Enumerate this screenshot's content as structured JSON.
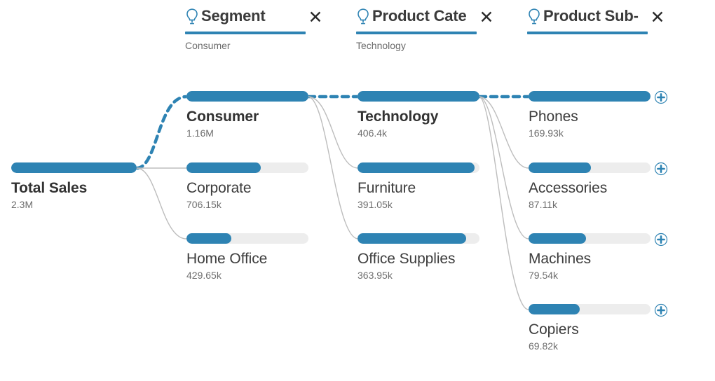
{
  "chart_data": {
    "type": "bar",
    "title": "Total Sales breakdown",
    "layout": "horizontal decomposition tree with connector links",
    "legend": "none",
    "grid": false,
    "root": {
      "label": "Total Sales",
      "value": "2.3M",
      "numeric": 2300000,
      "pct": 100,
      "selected": true
    },
    "columns": [
      {
        "dimension": "Segment",
        "selection": "Consumer",
        "items": [
          {
            "label": "Consumer",
            "value": "1.16M",
            "numeric": 1160000,
            "pct": 100,
            "selected": true
          },
          {
            "label": "Corporate",
            "value": "706.15k",
            "numeric": 706150,
            "pct": 61,
            "selected": false
          },
          {
            "label": "Home Office",
            "value": "429.65k",
            "numeric": 429650,
            "pct": 37,
            "selected": false
          }
        ]
      },
      {
        "dimension": "Product Category",
        "selection": "Technology",
        "items": [
          {
            "label": "Technology",
            "value": "406.4k",
            "numeric": 406400,
            "pct": 100,
            "selected": true
          },
          {
            "label": "Furniture",
            "value": "391.05k",
            "numeric": 391050,
            "pct": 96,
            "selected": false
          },
          {
            "label": "Office Supplies",
            "value": "363.95k",
            "numeric": 363950,
            "pct": 89,
            "selected": false
          }
        ]
      },
      {
        "dimension": "Product Sub-Category",
        "selection": "",
        "items": [
          {
            "label": "Phones",
            "value": "169.93k",
            "numeric": 169930,
            "pct": 100,
            "selected": false
          },
          {
            "label": "Accessories",
            "value": "87.11k",
            "numeric": 87110,
            "pct": 51,
            "selected": false
          },
          {
            "label": "Machines",
            "value": "79.54k",
            "numeric": 79540,
            "pct": 47,
            "selected": false
          },
          {
            "label": "Copiers",
            "value": "69.82k",
            "numeric": 69820,
            "pct": 42,
            "selected": false
          }
        ]
      }
    ]
  },
  "colors": {
    "accent": "#2e83b3",
    "bar_track": "#ededed",
    "link": "#bdbdbd",
    "link_active": "#2e83b3",
    "label": "#3d3d3d",
    "value": "#6e6e6e",
    "close": "#2b2b2b"
  },
  "breadcrumbs": [
    {
      "title": "Segment",
      "title_display": "Segment",
      "subtitle": "Consumer",
      "close_label": "✕",
      "icon": "lightbulb-icon",
      "truncated": false
    },
    {
      "title": "Product Category",
      "title_display": "Product Cate",
      "subtitle": "Technology",
      "close_label": "✕",
      "icon": "lightbulb-icon",
      "truncated": true
    },
    {
      "title": "Product Sub-Category",
      "title_display": "Product Sub-",
      "subtitle": "",
      "close_label": "✕",
      "icon": "lightbulb-icon",
      "truncated": true
    }
  ],
  "root": {
    "label": "Total Sales",
    "value": "2.3M"
  },
  "columns": [
    {
      "items": [
        {
          "label": "Consumer",
          "value": "1.16M"
        },
        {
          "label": "Corporate",
          "value": "706.15k"
        },
        {
          "label": "Home Office",
          "value": "429.65k"
        }
      ]
    },
    {
      "items": [
        {
          "label": "Technology",
          "value": "406.4k"
        },
        {
          "label": "Furniture",
          "value": "391.05k"
        },
        {
          "label": "Office Supplies",
          "value": "363.95k"
        }
      ]
    },
    {
      "items": [
        {
          "label": "Phones",
          "value": "169.93k"
        },
        {
          "label": "Accessories",
          "value": "87.11k"
        },
        {
          "label": "Machines",
          "value": "79.54k"
        },
        {
          "label": "Copiers",
          "value": "69.82k"
        }
      ]
    }
  ]
}
